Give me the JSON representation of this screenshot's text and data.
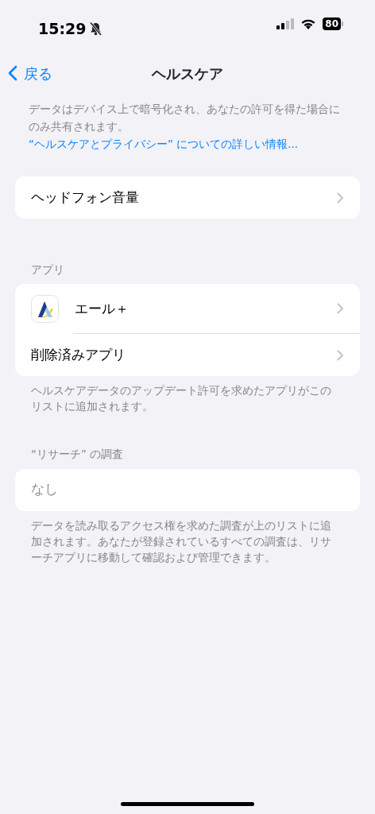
{
  "status_bar": {
    "time": "15:29",
    "battery": "80"
  },
  "nav": {
    "back": "戻る",
    "title": "ヘルスケア"
  },
  "intro": {
    "text": "データはデバイス上で暗号化され、あなたの許可を得た場合にのみ共有されます。",
    "link": "“ヘルスケアとプライバシー” についての詳しい情報..."
  },
  "sections": [
    {
      "rows": [
        {
          "kind": "nav",
          "label": "ヘッドフォン音量"
        }
      ]
    },
    {
      "header": "アプリ",
      "rows": [
        {
          "kind": "app",
          "label": "エール＋"
        },
        {
          "kind": "nav",
          "label": "削除済みアプリ"
        }
      ],
      "footer": "ヘルスケアデータのアップデート許可を求めたアプリがこのリストに追加されます。"
    },
    {
      "header": "“リサーチ” の調査",
      "rows": [
        {
          "kind": "empty",
          "label": "なし"
        }
      ],
      "footer": "データを読み取るアクセス権を求めた調査が上のリストに追加されます。あなたが登録されているすべての調査は、リサーチアプリに移動して確認および管理できます。"
    }
  ]
}
